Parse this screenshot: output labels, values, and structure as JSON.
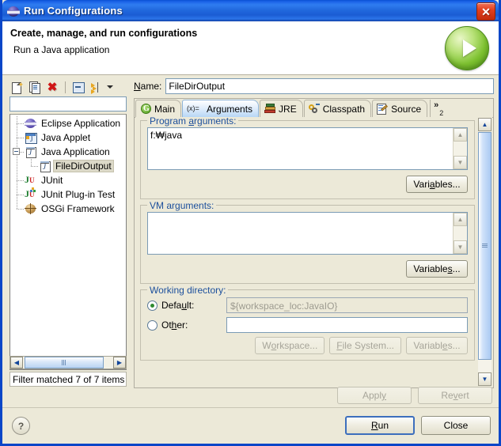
{
  "window": {
    "title": "Run Configurations",
    "title_icon": "eclipse-globe-icon",
    "close_label": "✕"
  },
  "banner": {
    "title": "Create, manage, and run configurations",
    "subtitle": "Run a Java application",
    "icon": "run-green-play-icon"
  },
  "tree_toolbar": {
    "items": [
      {
        "name": "new-configuration-button",
        "icon": "new-document-icon"
      },
      {
        "name": "duplicate-configuration-button",
        "icon": "copy-document-icon"
      },
      {
        "name": "delete-configuration-button",
        "icon": "delete-red-x-icon",
        "glyph": "✖"
      },
      {
        "name": "collapse-all-button",
        "icon": "collapse-all-icon"
      },
      {
        "name": "filter-button",
        "icon": "filter-arrows-icon"
      },
      {
        "name": "view-menu-button",
        "icon": "chevron-down-icon"
      }
    ]
  },
  "filter": {
    "value": "",
    "placeholder": "",
    "status": "Filter matched 7 of 7 items"
  },
  "tree": {
    "items": [
      {
        "label": "Eclipse Application",
        "icon": "eclipse-application-icon",
        "indent": 1,
        "expander": false,
        "selected": false
      },
      {
        "label": "Java Applet",
        "icon": "java-applet-icon",
        "indent": 1,
        "expander": false,
        "selected": false
      },
      {
        "label": "Java Application",
        "icon": "java-application-icon",
        "indent": 1,
        "expander": true,
        "selected": false
      },
      {
        "label": "FileDirOutput",
        "icon": "java-application-icon",
        "indent": 2,
        "expander": false,
        "selected": true
      },
      {
        "label": "JUnit",
        "icon": "junit-icon",
        "indent": 1,
        "expander": false,
        "selected": false
      },
      {
        "label": "JUnit Plug-in Test",
        "icon": "junit-plugin-test-icon",
        "indent": 1,
        "expander": false,
        "selected": false
      },
      {
        "label": "OSGi Framework",
        "icon": "osgi-framework-icon",
        "indent": 1,
        "expander": false,
        "selected": false
      }
    ]
  },
  "name_field": {
    "label": "Name:",
    "label_mnemonic": "N",
    "value": "FileDirOutput"
  },
  "tabs": [
    {
      "label": "Main",
      "icon": "main-tab-icon",
      "active": false
    },
    {
      "label": "Arguments",
      "icon": "arguments-tab-icon",
      "active": true
    },
    {
      "label": "JRE",
      "icon": "jre-tab-icon",
      "active": false
    },
    {
      "label": "Classpath",
      "icon": "classpath-tab-icon",
      "active": false
    },
    {
      "label": "Source",
      "icon": "source-tab-icon",
      "active": false
    }
  ],
  "tab_overflow": {
    "glyph": "»",
    "count": "2"
  },
  "program_arguments": {
    "legend": "Program arguments:",
    "legend_mnemonic": "a",
    "value": "f:₩java",
    "variables_button": "Variables...",
    "variables_mnemonic": "a"
  },
  "vm_arguments": {
    "legend": "VM arguments:",
    "legend_mnemonic": "g",
    "value": "",
    "variables_button": "Variables...",
    "variables_mnemonic": "s"
  },
  "working_directory": {
    "legend": "Working directory:",
    "default_label": "Default:",
    "default_mnemonic": "u",
    "default_selected": true,
    "default_value": "${workspace_loc:JavaIO}",
    "other_label": "Other:",
    "other_mnemonic": "h",
    "other_selected": false,
    "other_value": "",
    "buttons": [
      {
        "label": "Workspace...",
        "mnemonic": "o",
        "enabled": false
      },
      {
        "label": "File System...",
        "mnemonic": "F",
        "enabled": false
      },
      {
        "label": "Variables...",
        "mnemonic": "e",
        "enabled": false
      }
    ]
  },
  "form_buttons": {
    "apply": "Apply",
    "apply_mnemonic": "y",
    "apply_enabled": false,
    "revert": "Revert",
    "revert_mnemonic": "v",
    "revert_enabled": false
  },
  "footer": {
    "help_glyph": "?",
    "run": "Run",
    "run_mnemonic": "R",
    "close": "Close"
  },
  "colors": {
    "titlebar_blue": "#2168dd",
    "window_border": "#0a46c8",
    "dialog_bg": "#ece9d8",
    "group_legend_blue": "#1c4f9c",
    "selection_gray": "#dcd9c8",
    "close_red": "#d4380f",
    "run_green": "#7cc02f"
  }
}
